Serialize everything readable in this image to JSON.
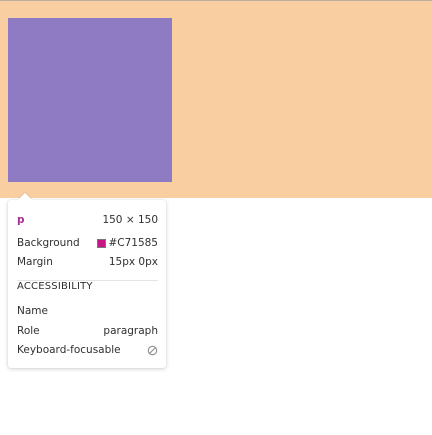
{
  "element": {
    "tag": "p",
    "dimensions": "150 × 150"
  },
  "styles": [
    {
      "label": "Background",
      "value": "#C71585",
      "swatch_color": "#C71585"
    },
    {
      "label": "Margin",
      "value": "15px 0px"
    }
  ],
  "accessibility": {
    "title": "ACCESSIBILITY",
    "name_label": "Name",
    "name_value": "",
    "role_label": "Role",
    "role_value": "paragraph",
    "focusable_label": "Keyboard-focusable",
    "focusable_icon": "not-focusable-icon"
  },
  "colors": {
    "overlay_margin": "#f9cfa1",
    "overlay_content": "#8f7bc3"
  }
}
